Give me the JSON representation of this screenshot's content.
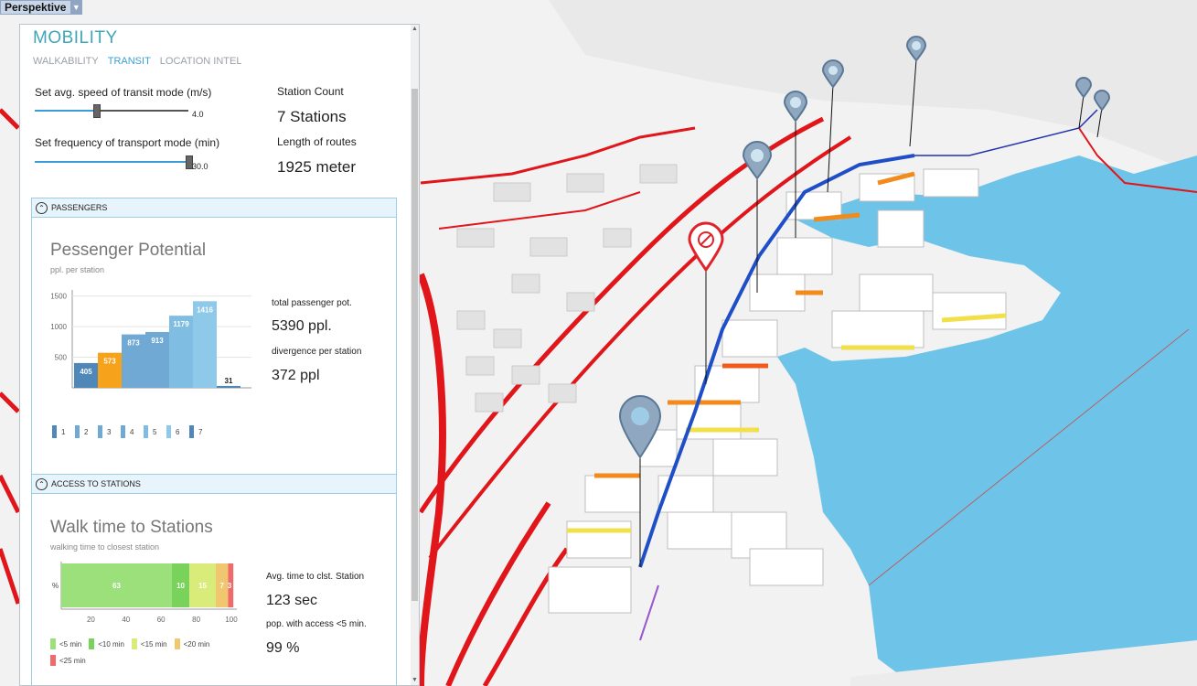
{
  "viewport": {
    "label": "Perspektive"
  },
  "panel": {
    "title": "MOBILITY",
    "tabs": [
      {
        "label": "WALKABILITY",
        "active": false
      },
      {
        "label": "TRANSIT",
        "active": true
      },
      {
        "label": "LOCATION INTEL",
        "active": false
      }
    ],
    "speed": {
      "label": "Set avg. speed of transit mode (m/s)",
      "value": "4.0",
      "fraction": 0.4
    },
    "frequency": {
      "label": "Set frequency of transport mode (min)",
      "value": "30.0",
      "fraction": 1.0
    },
    "station_count": {
      "label": "Station Count",
      "value": "7 Stations"
    },
    "route_length": {
      "label": "Length of routes",
      "value": "1925 meter"
    },
    "passengers": {
      "header": "PASSENGERS",
      "title": "Pessenger Potential",
      "subtitle": "ppl. per station",
      "total_label": "total passenger pot.",
      "total_value": "5390 ppl.",
      "divergence_label": "divergence per station",
      "divergence_value": "372 ppl"
    },
    "access": {
      "header": "ACCESS TO STATIONS",
      "title": "Walk time to Stations",
      "subtitle": "walking time to closest station",
      "avg_label": "Avg. time to clst. Station",
      "avg_value": "123 sec",
      "pop_label": "pop. with access <5 min.",
      "pop_value": "99 %"
    }
  },
  "chart_data": [
    {
      "type": "bar",
      "categories": [
        "1",
        "2",
        "3",
        "4",
        "5",
        "6",
        "7"
      ],
      "values": [
        405,
        573,
        873,
        913,
        1179,
        1416,
        31
      ],
      "colors": [
        "#4f87b8",
        "#f7a21b",
        "#6fa9d4",
        "#6fa9d4",
        "#7fbde2",
        "#8fc9ea",
        "#4f87b8"
      ],
      "ylim": [
        0,
        1600
      ],
      "yticks": [
        500,
        1000,
        1500
      ]
    },
    {
      "type": "bar",
      "orientation": "horizontal-stacked",
      "ylabel": "%",
      "xlim": [
        0,
        100
      ],
      "xticks": [
        20,
        40,
        60,
        80,
        100
      ],
      "segments": [
        {
          "name": "<5 min",
          "value": 63,
          "color": "#9be07b"
        },
        {
          "name": "<10 min",
          "value": 10,
          "color": "#79d35a"
        },
        {
          "name": "<15 min",
          "value": 15,
          "color": "#d9ec7a"
        },
        {
          "name": "<20 min",
          "value": 7,
          "color": "#f0c66e"
        },
        {
          "name": "<25 min",
          "value": 3,
          "color": "#ef6b6b"
        }
      ]
    }
  ]
}
